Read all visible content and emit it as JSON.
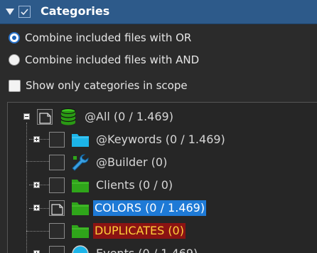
{
  "header": {
    "title": "Categories"
  },
  "options": {
    "combine_or": "Combine included files with OR",
    "combine_and": "Combine included files with AND",
    "show_scope": "Show only categories in scope"
  },
  "tree": {
    "items": [
      {
        "label": "@All (0 / 1.469)"
      },
      {
        "label": "@Keywords (0 / 1.469)"
      },
      {
        "label": "@Builder (0)"
      },
      {
        "label": "Clients (0 / 0)"
      },
      {
        "label": "COLORS (0 / 1.469)"
      },
      {
        "label": "DUPLICATES (0)"
      },
      {
        "label": "Events (0 / 1.469)"
      }
    ]
  },
  "colors": {
    "header_bg": "#2d5a8a",
    "selection": "#1e7ad6",
    "duplicates_bg": "#8b1313",
    "duplicates_text": "#ffcf3a",
    "folder_green": "#2fa51a",
    "folder_cyan": "#1cb4e8"
  }
}
